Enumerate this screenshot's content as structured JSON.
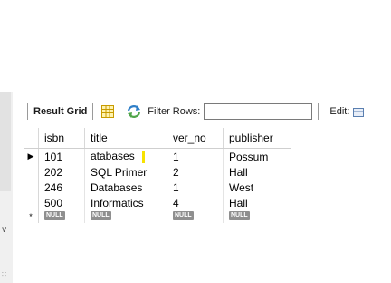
{
  "toolbar": {
    "result_grid_label": "Result Grid",
    "filter_label": "Filter Rows:",
    "filter_value": "",
    "edit_label": "Edit:"
  },
  "grid": {
    "columns": [
      "isbn",
      "title",
      "ver_no",
      "publisher"
    ],
    "rows": [
      [
        "101",
        "atabases",
        "1",
        "Possum"
      ],
      [
        "202",
        "SQL Primer",
        "2",
        "Hall"
      ],
      [
        "246",
        "Databases",
        "1",
        "West"
      ],
      [
        "500",
        "Informatics",
        "4",
        "Hall"
      ]
    ],
    "current_row_marker": "▶",
    "new_row_marker": "*",
    "null_label": "NULL"
  },
  "colors": {
    "cursor_highlight": "#f7e200",
    "null_badge": "#8f8f8f"
  }
}
